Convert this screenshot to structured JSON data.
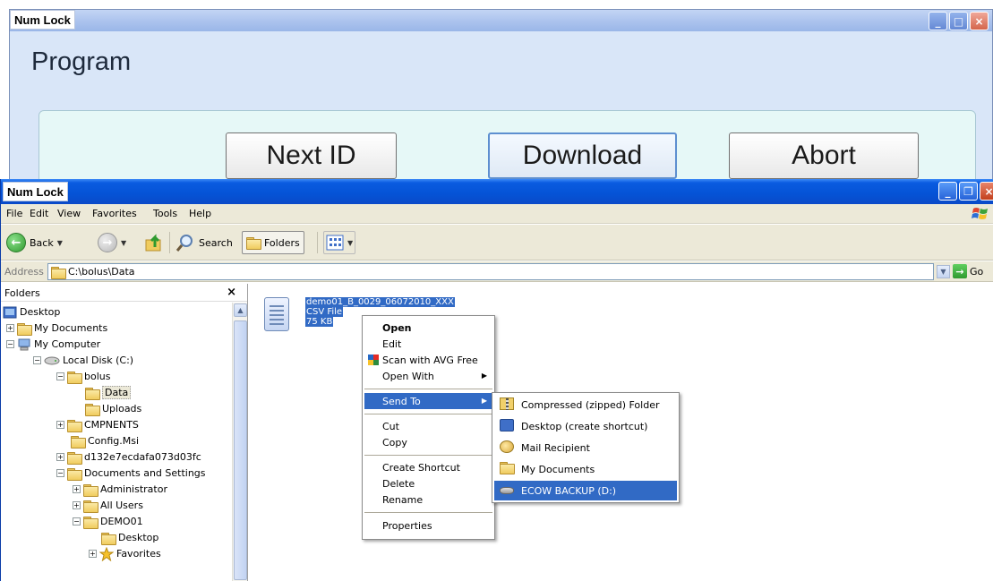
{
  "back_window": {
    "title": "Num Lock",
    "heading": "Program",
    "buttons": {
      "next_id": "Next ID",
      "download": "Download",
      "abort": "Abort"
    },
    "controls": {
      "minimize": "_",
      "maximize": "□",
      "close": "×"
    }
  },
  "explorer": {
    "title": "Num Lock",
    "controls": {
      "minimize": "_",
      "restore": "❐",
      "close": "×"
    },
    "menu": [
      "File",
      "Edit",
      "View",
      "Favorites",
      "Tools",
      "Help"
    ],
    "toolbar": {
      "back": "Back",
      "search": "Search",
      "folders": "Folders"
    },
    "address": {
      "label": "Address",
      "value": "C:\\bolus\\Data",
      "go": "Go"
    },
    "folders_pane": {
      "title": "Folders",
      "close": "×",
      "tree": [
        {
          "label": "Desktop",
          "expander": ""
        },
        {
          "label": "My Documents",
          "expander": "+"
        },
        {
          "label": "My Computer",
          "expander": "−"
        },
        {
          "label": "Local Disk (C:)",
          "expander": "−"
        },
        {
          "label": "bolus",
          "expander": "−"
        },
        {
          "label": "Data",
          "expander": ""
        },
        {
          "label": "Uploads",
          "expander": ""
        },
        {
          "label": "CMPNENTS",
          "expander": "+"
        },
        {
          "label": "Config.Msi",
          "expander": ""
        },
        {
          "label": "d132e7ecdafa073d03fc",
          "expander": "+"
        },
        {
          "label": "Documents and Settings",
          "expander": "−"
        },
        {
          "label": "Administrator",
          "expander": "+"
        },
        {
          "label": "All Users",
          "expander": "+"
        },
        {
          "label": "DEMO01",
          "expander": "−"
        },
        {
          "label": "Desktop",
          "expander": ""
        },
        {
          "label": "Favorites",
          "expander": "+"
        }
      ]
    },
    "file": {
      "name": "demo01_B_0029_06072010_XXX",
      "type": "CSV File",
      "size": "75 KB"
    }
  },
  "context_menu": {
    "items": {
      "open": "Open",
      "edit": "Edit",
      "scan": "Scan with AVG Free",
      "open_with": "Open With",
      "send_to": "Send To",
      "cut": "Cut",
      "copy": "Copy",
      "create_shortcut": "Create Shortcut",
      "delete": "Delete",
      "rename": "Rename",
      "properties": "Properties"
    },
    "arrow": "▶"
  },
  "send_to_menu": {
    "items": [
      "Compressed (zipped) Folder",
      "Desktop (create shortcut)",
      "Mail Recipient",
      "My Documents",
      "ECOW BACKUP (D:)"
    ]
  }
}
